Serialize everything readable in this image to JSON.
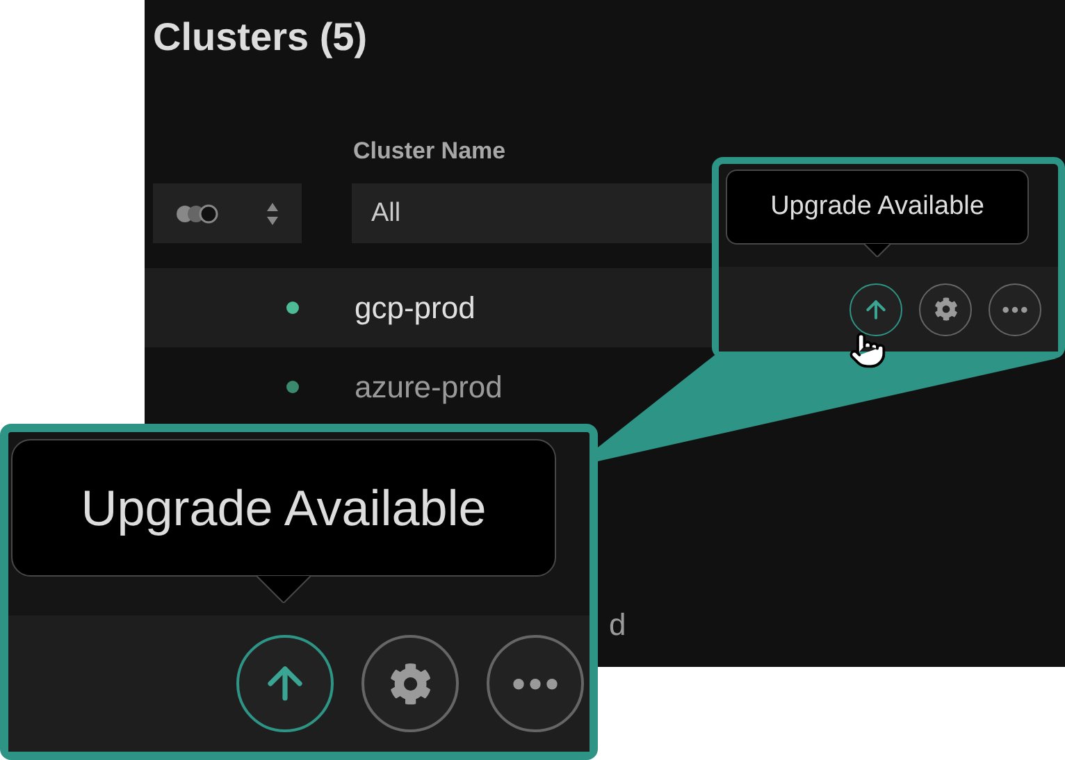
{
  "title": "Clusters (5)",
  "table": {
    "columns": [
      "Cluster Name"
    ],
    "filter": {
      "value": "All"
    },
    "rows": [
      {
        "kind": "full",
        "name": "gcp-prod",
        "color": "#4dbb95",
        "highlighted": true
      },
      {
        "kind": "full",
        "name": "azure-prod",
        "color": "#3a8a6d",
        "highlighted": false
      },
      {
        "kind": "cut",
        "name": "d",
        "highlighted": false
      }
    ]
  },
  "callouts": [
    {
      "kind": "small",
      "tooltip": "Upgrade Available",
      "actions": [
        {
          "kind": "upgrade",
          "highlighted": true
        },
        {
          "kind": "settings",
          "highlighted": false
        },
        {
          "kind": "more",
          "highlighted": false
        }
      ]
    },
    {
      "kind": "large",
      "tooltip": "Upgrade Available",
      "actions": [
        {
          "kind": "upgrade",
          "highlighted": true
        },
        {
          "kind": "settings",
          "highlighted": false
        },
        {
          "kind": "more",
          "highlighted": false
        }
      ]
    }
  ]
}
